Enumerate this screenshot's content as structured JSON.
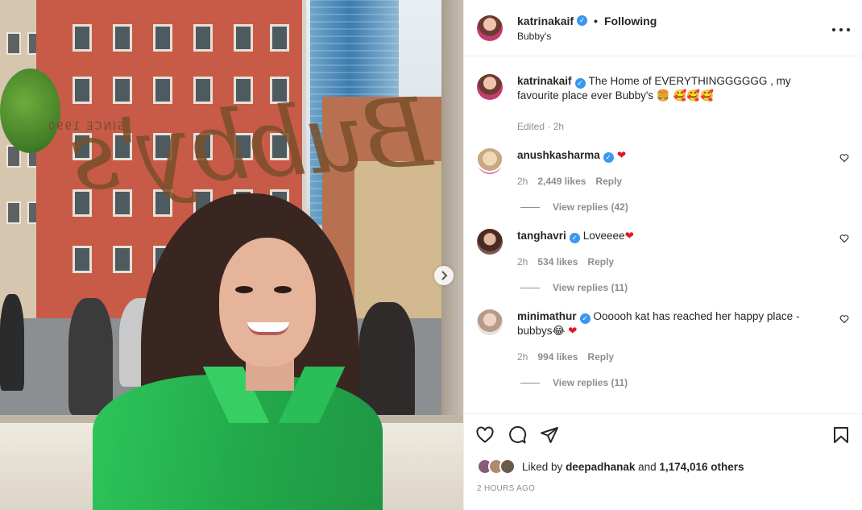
{
  "header": {
    "username": "katrinakaif",
    "verified_mark": "✓",
    "separator": "•",
    "follow_state": "Following",
    "location": "Bubby's",
    "more_icon": "more-horizontal-icon"
  },
  "photo": {
    "logo_text": "Bubby's",
    "since_text": "SINCE 1990",
    "next_icon": "chevron-right-icon"
  },
  "caption": {
    "username": "katrinakaif",
    "text": "The Home of EVERYTHINGGGGGG , my favourite place ever Bubby's 🍔 🥰🥰🥰",
    "meta": "Edited · 2h"
  },
  "comments": [
    {
      "username": "anushkasharma",
      "verified": true,
      "text": "",
      "emoji": "❤",
      "time": "2h",
      "likes": "2,449 likes",
      "reply": "Reply",
      "view_replies": "View replies (42)"
    },
    {
      "username": "tanghavri",
      "verified": true,
      "text": "Loveeee",
      "emoji": "❤",
      "time": "2h",
      "likes": "534 likes",
      "reply": "Reply",
      "view_replies": "View replies (11)"
    },
    {
      "username": "minimathur",
      "verified": true,
      "text": "Oooooh kat has reached her happy place - bubbys😂",
      "emoji": "❤",
      "time": "2h",
      "likes": "994 likes",
      "reply": "Reply",
      "view_replies": "View replies (11)"
    }
  ],
  "actions": {
    "like_icon": "heart-icon",
    "comment_icon": "comment-icon",
    "share_icon": "send-icon",
    "save_icon": "bookmark-icon"
  },
  "likes": {
    "prefix": "Liked by",
    "user": "deepadhanak",
    "middle": "and",
    "others": "1,174,016 others"
  },
  "timestamp": "2 HOURS AGO",
  "colors": {
    "verified": "#3897f0",
    "heart": "#e0182a",
    "muted": "#8e8e8e",
    "shirt": "#22a84a"
  }
}
